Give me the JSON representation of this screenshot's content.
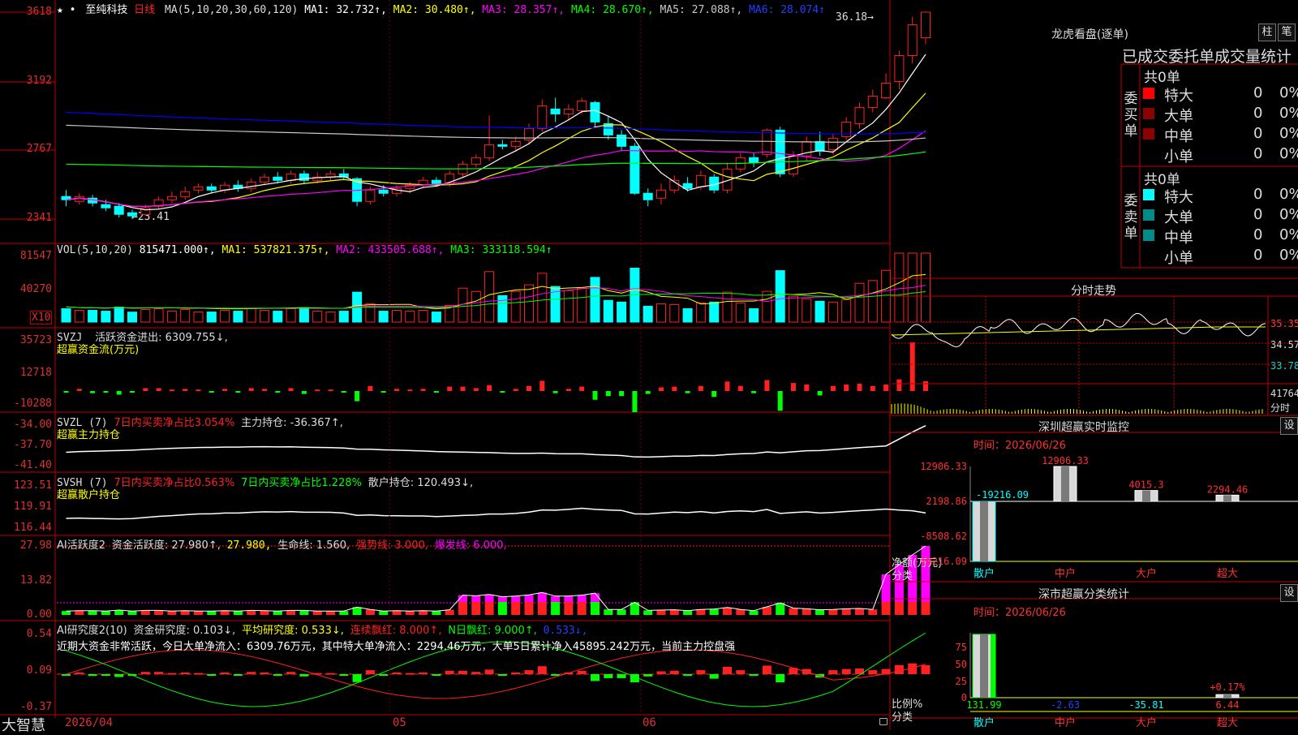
{
  "colors": {
    "up": "#ff2020",
    "down": "#00ffff",
    "frame": "#c00000",
    "ma1": "#ffffff",
    "ma2": "#ffff00",
    "ma3": "#ff00ff",
    "ma4": "#00ff00",
    "ma5": "#c8c8c8",
    "ma6": "#0000ff",
    "green": "#00ff00",
    "cyan": "#00e0e0",
    "magenta": "#ff00ff",
    "yellow": "#ffff00"
  },
  "main": {
    "title_icons": "★ •",
    "stock_name": "至纯科技",
    "period": "日线",
    "ma_label": "MA(5,10,20,30,60,120)",
    "ma1": "MA1: 32.732↑,",
    "ma2": "MA2: 30.480↑,",
    "ma3": "MA3: 28.357↑,",
    "ma4": "MA4: 28.670↑,",
    "ma5": "MA5: 27.088↑,",
    "ma6": "MA6: 28.074↑",
    "high_note": "36.18→",
    "low_note": "←23.41",
    "y_labels": [
      "3618",
      "3192",
      "2767",
      "2341"
    ]
  },
  "vol": {
    "label": "VOL(5,10,20)",
    "value": "815471.000↑,",
    "ma1": "MA1: 537821.375↑,",
    "ma2": "MA2: 433505.688↑,",
    "ma3": "MA3: 333118.594↑",
    "y_labels": [
      "81547",
      "40270"
    ],
    "unit": "X10"
  },
  "svzj": {
    "label": "SVZJ",
    "desc": "活跃资金进出: 6309.755↓,",
    "sub": "超赢资金流(万元)",
    "y_labels": [
      "35723",
      "12718",
      "-10288"
    ]
  },
  "svzl": {
    "label": "SVZL (7)",
    "desc1": "7日内买卖净占比3.054%",
    "desc2": "主力持仓: -36.367↑,",
    "sub": "超赢主力持仓",
    "y_labels": [
      "-34.00",
      "-37.70",
      "-41.40"
    ]
  },
  "svsh": {
    "label": "SVSH (7)",
    "desc1": "7日内买卖净占比0.563%",
    "desc2": "7日内买卖净占比1.228%",
    "desc3": "散户持仓: 120.493↓,",
    "sub": "超赢散户持仓",
    "y_labels": [
      "123.51",
      "119.91",
      "116.44"
    ]
  },
  "ai1": {
    "label": "AI活跃度2",
    "desc": "资金活跃度: 27.980↑,",
    "v2": "27.980,",
    "v3": "生命线: 1.560,",
    "v4": "强势线: 3.000,",
    "v5": "爆发线: 6.000,",
    "y_labels": [
      "27.98",
      "13.82",
      "0.00"
    ]
  },
  "ai2": {
    "label": "AI研究度2(10)",
    "d1": "资金研究度: 0.103↓,",
    "d2": "平均研究度: 0.533↓,",
    "d3": "连续飘红: 8.000↑,",
    "d4": "N日飘红: 9.000↑,",
    "d5": "0.533↓,",
    "note": "近期大资金非常活跃，今日大单净流入：6309.76万元，其中特大单净流入：2294.46万元，大单5日累计净入45895.242万元，当前主力控盘强",
    "y_labels": [
      "0.54",
      "0.09",
      "-0.37"
    ]
  },
  "bottom": {
    "brand": "大智慧",
    "date_label": "2026/04",
    "months": [
      "05",
      "06"
    ]
  },
  "right": {
    "lhb_title": "龙虎看盘(逐单)",
    "btn_zhu": "柱",
    "btn_bi": "笔",
    "trade_header": "已成交委托单成交量统计",
    "buy_side": "委买单",
    "sell_side": "委卖单",
    "buy_total": "共0单",
    "sell_total": "共0单",
    "buy_rows": [
      {
        "name": "特大",
        "n": "0",
        "p": "0%",
        "color": "#ff0000"
      },
      {
        "name": "大单",
        "n": "0",
        "p": "0%",
        "color": "#8b0000"
      },
      {
        "name": "中单",
        "n": "0",
        "p": "0%",
        "color": "#8b0000"
      },
      {
        "name": "小单",
        "n": "0",
        "p": "0%",
        "color": ""
      }
    ],
    "sell_rows": [
      {
        "name": "特大",
        "n": "0",
        "p": "0%",
        "color": "#00ffff"
      },
      {
        "name": "大单",
        "n": "0",
        "p": "0%",
        "color": "#008b8b"
      },
      {
        "name": "中单",
        "n": "0",
        "p": "0%",
        "color": "#008b8b"
      },
      {
        "name": "小单",
        "n": "0",
        "p": "0%",
        "color": ""
      }
    ],
    "fs_title": "分时走势",
    "fs_y": [
      "35.35",
      "34.57",
      "33.78"
    ],
    "fs_vol": "41764",
    "fs_vol_lbl": "分时",
    "sz_title": "深圳超赢实时监控",
    "sz_set": "设",
    "sz_date": "时间：2026/06/26",
    "sz_y": [
      "12906.33",
      "2198.86",
      "-8508.62",
      "-19216.09"
    ],
    "sz_values": [
      {
        "cat": "散户",
        "val": -19216.09,
        "lbl": "-19216.09"
      },
      {
        "cat": "中户",
        "val": 12906.33,
        "lbl": "12906.33"
      },
      {
        "cat": "大户",
        "val": 4015.3,
        "lbl": "4015.3"
      },
      {
        "cat": "超大",
        "val": 2294.46,
        "lbl": "2294.46"
      }
    ],
    "sz_axis1": "净额(万元)",
    "sz_axis2": "分类",
    "fl_title": "深市超赢分类统计",
    "fl_set": "设",
    "fl_date": "时间：2026/06/26",
    "fl_y": [
      "75",
      "50",
      "25",
      "0"
    ],
    "fl_values": [
      {
        "cat": "散户",
        "val": 131.99,
        "lbl": "131.99"
      },
      {
        "cat": "中户",
        "val": -2.63,
        "lbl": "-2.63"
      },
      {
        "cat": "大户",
        "val": -35.81,
        "lbl": "-35.81"
      },
      {
        "cat": "超大",
        "val": 6.44,
        "lbl": "6.44",
        "extra": "+0.17%"
      }
    ],
    "fl_axis1": "比例%",
    "fl_axis2": "分类"
  },
  "chart_data": [
    {
      "type": "candlestick",
      "title": "至纯科技 日线",
      "ylim": [
        23.41,
        36.18
      ],
      "y_ticks": [
        "3618",
        "3192",
        "2767",
        "2341"
      ],
      "candles": [
        [
          24.8,
          24.6,
          25.2,
          24.2
        ],
        [
          24.5,
          24.8,
          25.0,
          24.3
        ],
        [
          24.7,
          24.4,
          24.9,
          24.2
        ],
        [
          24.3,
          24.1,
          24.6,
          23.9
        ],
        [
          24.2,
          23.7,
          24.4,
          23.5
        ],
        [
          23.8,
          23.6,
          24.0,
          23.41
        ],
        [
          23.7,
          24.1,
          24.3,
          23.6
        ],
        [
          24.2,
          24.6,
          24.8,
          24.0
        ],
        [
          24.6,
          24.8,
          25.1,
          24.4
        ],
        [
          24.8,
          25.1,
          25.4,
          24.6
        ],
        [
          25.2,
          25.4,
          25.6,
          25.0
        ],
        [
          25.4,
          25.2,
          25.6,
          25.0
        ],
        [
          25.2,
          25.5,
          25.7,
          25.0
        ],
        [
          25.5,
          25.3,
          25.8,
          25.1
        ],
        [
          25.3,
          25.7,
          25.9,
          25.1
        ],
        [
          25.7,
          26.0,
          26.2,
          25.5
        ],
        [
          26.0,
          25.8,
          26.3,
          25.6
        ],
        [
          25.8,
          26.2,
          26.4,
          25.6
        ],
        [
          26.2,
          25.8,
          26.4,
          25.6
        ],
        [
          25.8,
          26.0,
          26.3,
          25.6
        ],
        [
          26.0,
          26.2,
          26.4,
          25.8
        ],
        [
          26.2,
          26.0,
          26.5,
          25.8
        ],
        [
          25.9,
          24.5,
          26.0,
          24.2
        ],
        [
          24.5,
          25.2,
          25.4,
          24.3
        ],
        [
          25.2,
          25.0,
          25.5,
          24.8
        ],
        [
          25.0,
          25.3,
          25.5,
          24.8
        ],
        [
          25.3,
          25.5,
          25.7,
          25.0
        ],
        [
          25.5,
          25.8,
          26.0,
          25.3
        ],
        [
          25.8,
          25.6,
          26.0,
          25.4
        ],
        [
          25.6,
          26.2,
          26.4,
          25.4
        ],
        [
          26.2,
          26.8,
          27.0,
          26.0
        ],
        [
          26.8,
          27.2,
          27.4,
          26.6
        ],
        [
          27.2,
          28.0,
          29.8,
          27.0
        ],
        [
          28.0,
          27.9,
          28.3,
          27.7
        ],
        [
          27.9,
          28.2,
          28.5,
          27.6
        ],
        [
          28.3,
          29.0,
          29.3,
          28.0
        ],
        [
          29.0,
          30.4,
          30.8,
          28.8
        ],
        [
          30.2,
          29.9,
          30.9,
          29.4
        ],
        [
          29.9,
          30.2,
          30.5,
          29.5
        ],
        [
          30.1,
          30.7,
          30.9,
          29.9
        ],
        [
          30.6,
          29.4,
          30.7,
          29.0
        ],
        [
          29.3,
          28.6,
          29.8,
          28.3
        ],
        [
          28.6,
          27.9,
          28.9,
          27.6
        ],
        [
          27.9,
          25.0,
          28.1,
          24.9
        ],
        [
          25.0,
          24.6,
          25.3,
          24.2
        ],
        [
          24.7,
          25.2,
          25.6,
          24.3
        ],
        [
          25.2,
          25.8,
          26.1,
          25.0
        ],
        [
          25.6,
          25.3,
          26.0,
          25.1
        ],
        [
          25.4,
          26.1,
          26.4,
          25.2
        ],
        [
          26.0,
          25.2,
          26.2,
          25.0
        ],
        [
          25.2,
          26.5,
          26.9,
          25.0
        ],
        [
          26.5,
          27.2,
          27.5,
          26.3
        ],
        [
          27.2,
          26.9,
          27.5,
          26.6
        ],
        [
          27.4,
          28.9,
          29.0,
          27.2
        ],
        [
          28.9,
          26.2,
          29.1,
          26.0
        ],
        [
          26.2,
          27.3,
          27.6,
          26.0
        ],
        [
          27.3,
          28.2,
          28.5,
          27.0
        ],
        [
          28.2,
          27.6,
          28.8,
          27.3
        ],
        [
          27.7,
          28.4,
          28.7,
          27.4
        ],
        [
          28.5,
          29.4,
          29.7,
          28.3
        ],
        [
          29.3,
          30.3,
          30.6,
          29.0
        ],
        [
          30.3,
          31.0,
          31.4,
          30.0
        ],
        [
          30.9,
          31.8,
          32.4,
          30.8
        ],
        [
          31.9,
          33.5,
          33.8,
          31.4
        ],
        [
          33.5,
          35.4,
          35.9,
          33.0
        ],
        [
          34.6,
          36.18,
          36.18,
          34.2
        ]
      ]
    }
  ]
}
